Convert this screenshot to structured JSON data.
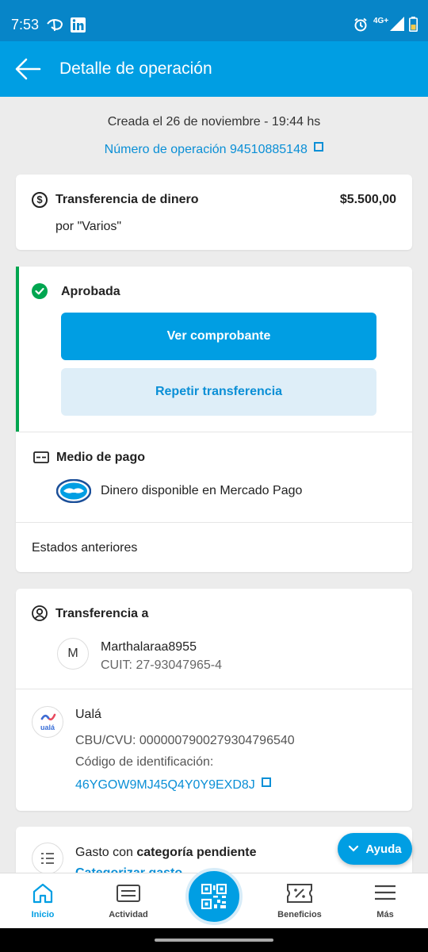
{
  "status_bar": {
    "time": "7:53",
    "network": "4G+",
    "icons": [
      "disney-icon",
      "linkedin-icon",
      "alarm-icon",
      "signal-icon",
      "battery-icon"
    ]
  },
  "header": {
    "title": "Detalle de operación",
    "back_icon": "arrow-left-icon"
  },
  "operation": {
    "created": "Creada el 26 de noviembre - 19:44 hs",
    "number_label": "Número de operación 94510885148"
  },
  "summary": {
    "title": "Transferencia de dinero",
    "amount": "$5.500,00",
    "subtitle": "por \"Varios\""
  },
  "status": {
    "label": "Aprobada",
    "primary_button": "Ver comprobante",
    "secondary_button": "Repetir transferencia"
  },
  "payment": {
    "title": "Medio de pago",
    "method": "Dinero disponible en Mercado Pago"
  },
  "history": {
    "label": "Estados anteriores"
  },
  "recipient": {
    "title": "Transferencia a",
    "avatar_initial": "M",
    "name": "Marthalaraa8955",
    "cuit": "CUIT: 27-93047965-4",
    "bank_name": "Ualá",
    "bank_logo_text": "ualá",
    "cbu": "CBU/CVU: 0000007900279304796540",
    "id_label": "Código de identificación:",
    "id_value": "46YGOW9MJ45Q4Y0Y9EXD8J"
  },
  "category": {
    "text_prefix": "Gasto con ",
    "text_bold": "categoría pendiente",
    "link": "Categorizar gasto"
  },
  "help_button": "Ayuda",
  "bottom_nav": [
    {
      "label": "Inicio",
      "icon": "home-icon",
      "active": true
    },
    {
      "label": "Actividad",
      "icon": "activity-icon",
      "active": false
    },
    {
      "label": "",
      "icon": "qr-icon",
      "active": false
    },
    {
      "label": "Beneficios",
      "icon": "ticket-icon",
      "active": false
    },
    {
      "label": "Más",
      "icon": "menu-icon",
      "active": false
    }
  ],
  "colors": {
    "brand": "#009ee3",
    "status_bar": "#0785c8",
    "success": "#00a650",
    "link": "#0a8fd6"
  }
}
